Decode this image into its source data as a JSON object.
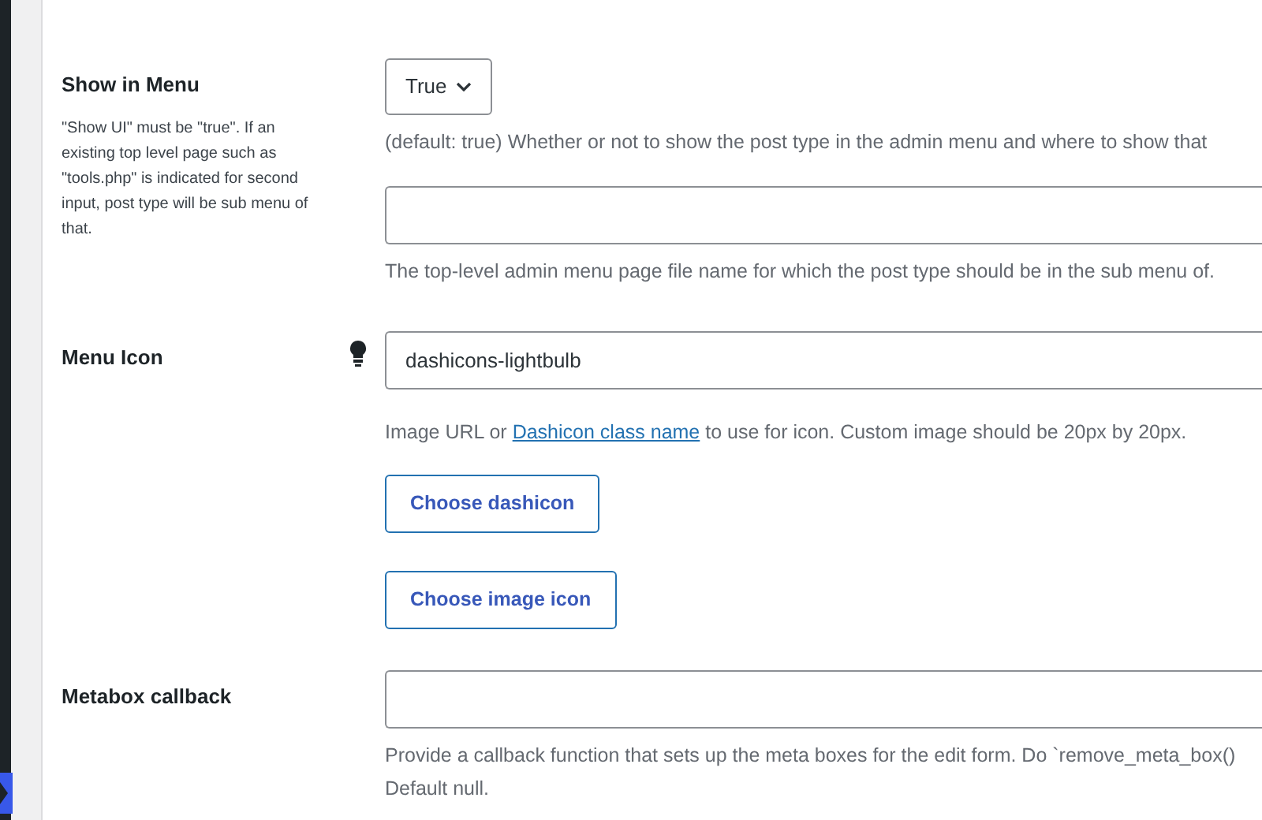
{
  "fields": [
    {
      "label": "Show in Menu",
      "note": "\"Show UI\" must be \"true\". If an existing top level page such as \"tools.php\" is indicated for second input, post type will be sub menu of that.",
      "controls": [
        {
          "kind": "select",
          "value": "True"
        },
        {
          "kind": "help",
          "text": "(default: true) Whether or not to show the post type in the admin menu and where to show that"
        },
        {
          "kind": "input"
        },
        {
          "kind": "help",
          "text": "The top-level admin menu page file name for which the post type should be in the sub menu of."
        }
      ]
    },
    {
      "label": "Menu Icon",
      "hint_icon": true,
      "controls": [
        {
          "kind": "input",
          "value": "dashicons-lightbulb"
        },
        {
          "kind": "help_link",
          "before": "Image URL or",
          "link": "Dashicon class name",
          "after": "to use for icon. Custom image should be 20px by 20px."
        },
        {
          "kind": "button",
          "text": "Choose dashicon"
        },
        {
          "kind": "button",
          "text": "Choose image icon"
        }
      ]
    },
    {
      "label": "Metabox callback",
      "controls": [
        {
          "kind": "input"
        },
        {
          "kind": "help",
          "text": "Provide a callback function that sets up the meta boxes for the edit form. Do `remove_meta_box()"
        },
        {
          "kind": "help",
          "text": "Default null."
        }
      ]
    }
  ]
}
